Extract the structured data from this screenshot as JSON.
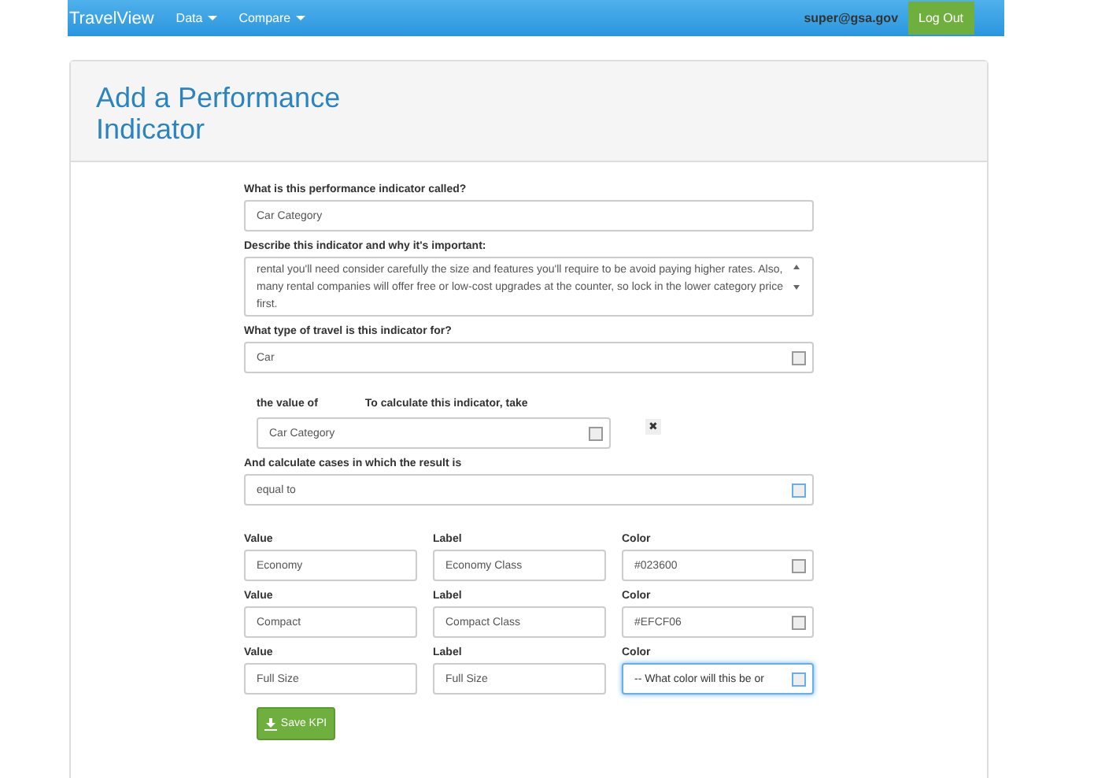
{
  "navbar": {
    "brand": "TravelView",
    "menus": [
      {
        "label": "Data"
      },
      {
        "label": "Compare"
      }
    ],
    "user": "super@gsa.gov",
    "logout": "Log Out"
  },
  "panel": {
    "title": "Add a Performance Indicator"
  },
  "form": {
    "name": {
      "label": "What is this performance indicator called?",
      "value": "Car Category"
    },
    "description": {
      "label": "Describe this indicator and why it's important:",
      "value": "rental you'll need consider carefully the size and features you'll require to be avoid paying higher rates. Also, many rental companies will offer free or low-cost upgrades at the counter, so lock in the lower category price first."
    },
    "travel_type": {
      "label": "What type of travel is this indicator for?",
      "value": "Car",
      "focused": false
    },
    "calculation": {
      "label_1": "the value of",
      "label_2": "To calculate this indicator, take",
      "value": "Car Category",
      "remove": "✖"
    },
    "result": {
      "label": "And calculate cases in which the result is",
      "value": "equal to",
      "focused": false
    },
    "cases": [
      {
        "value_label": "Value",
        "value": "Economy",
        "label_label": "Label",
        "label": "Economy Class",
        "color_label": "Color",
        "color_value": "#023600",
        "focused": false
      },
      {
        "value_label": "Value",
        "value": "Compact",
        "label_label": "Label",
        "label": "Compact Class",
        "color_label": "Color",
        "color_value": "#EFCF06",
        "focused": false
      },
      {
        "value_label": "Value",
        "value": "Full Size",
        "label_label": "Label",
        "label": "Full Size",
        "color_label": "Color",
        "color_value": "-- What color will this be or",
        "focused": true
      }
    ],
    "save": "Save KPI"
  }
}
